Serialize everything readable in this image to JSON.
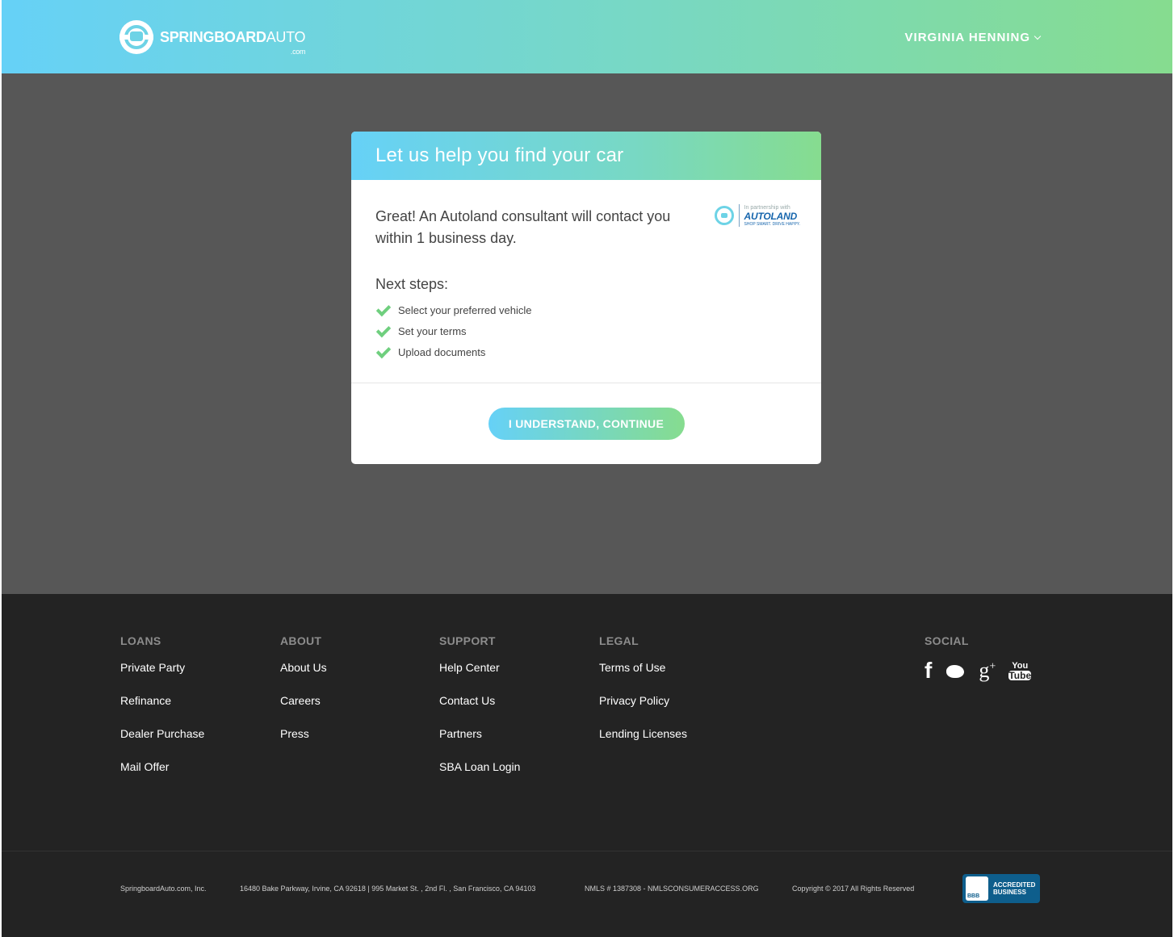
{
  "header": {
    "logo_bold": "SPRINGBOARD",
    "logo_light": "AUTO",
    "logo_suffix": ".com",
    "user_name": "VIRGINIA HENNING"
  },
  "modal": {
    "title": "Let us help you find your car",
    "message": "Great! An Autoland consultant will contact you within 1 business day.",
    "partner": {
      "label": "In partnership with",
      "brand": "AUTOLAND",
      "tagline": "SHOP SMART. DRIVE HAPPY."
    },
    "next_steps_title": "Next steps:",
    "steps": [
      "Select your preferred vehicle",
      "Set your terms",
      "Upload documents"
    ],
    "continue_label": "I UNDERSTAND, CONTINUE"
  },
  "footer": {
    "loans": {
      "heading": "LOANS",
      "links": [
        "Private Party",
        "Refinance",
        "Dealer Purchase",
        "Mail Offer"
      ]
    },
    "about": {
      "heading": "ABOUT",
      "links": [
        "About Us",
        "Careers",
        "Press"
      ]
    },
    "support": {
      "heading": "SUPPORT",
      "links": [
        "Help Center",
        "Contact Us",
        "Partners",
        "SBA Loan Login"
      ]
    },
    "legal": {
      "heading": "LEGAL",
      "links": [
        "Terms of Use",
        "Privacy Policy",
        "Lending Licenses"
      ]
    },
    "social": {
      "heading": "SOCIAL",
      "icons": [
        "facebook-icon",
        "twitter-icon",
        "google-plus-icon",
        "youtube-icon"
      ],
      "youtube_top": "You",
      "youtube_bottom": "Tube"
    },
    "company": "SpringboardAuto.com, Inc.",
    "address": "16480 Bake Parkway, Irvine, CA 92618 | 995 Market St. , 2nd Fl. , San Francisco, CA 94103",
    "nmls": "NMLS # 1387308 - NMLSCONSUMERACCESS.ORG",
    "copyright": "Copyright © 2017 All Rights Reserved",
    "bbb_line1": "ACCREDITED",
    "bbb_line2": "BUSINESS"
  },
  "colors": {
    "gradient_start": "#66d1f7",
    "gradient_end": "#86dc8f",
    "overlay": "#575757",
    "footer_bg": "#232323",
    "check": "#6fcf7e"
  }
}
